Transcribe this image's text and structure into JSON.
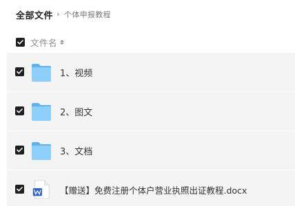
{
  "breadcrumb": {
    "root": "全部文件",
    "current": "个体申报教程"
  },
  "header": {
    "column_label": "文件名",
    "select_all_checked": true
  },
  "files": [
    {
      "name": "1、视频",
      "type": "folder",
      "checked": true,
      "icon": "folder-icon"
    },
    {
      "name": "2、图文",
      "type": "folder",
      "checked": true,
      "icon": "folder-icon"
    },
    {
      "name": "3、文档",
      "type": "folder",
      "checked": true,
      "icon": "folder-icon"
    },
    {
      "name": "【赠送】免费注册个体户营业执照出证教程.docx",
      "type": "docx",
      "checked": true,
      "icon": "word-doc-icon"
    }
  ],
  "colors": {
    "checkbox_fill": "#1e1e1e",
    "row_background": "#f4f4f4",
    "folder_blue": "#7cc4f7",
    "word_blue": "#2a63c8"
  }
}
